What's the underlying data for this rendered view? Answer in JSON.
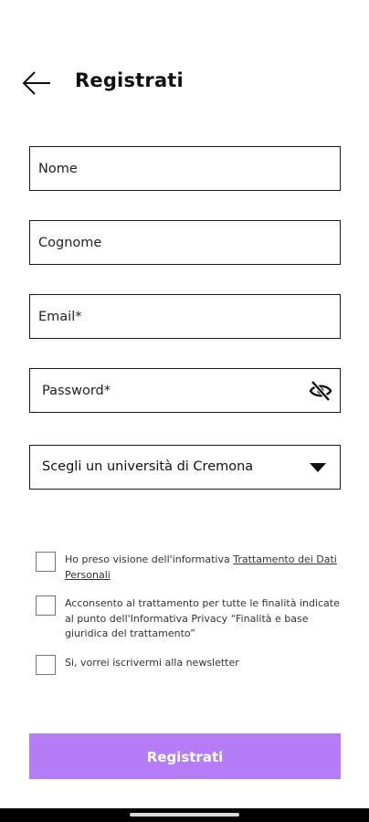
{
  "header": {
    "title": "Registrati",
    "back_icon": "arrow-left-icon"
  },
  "form": {
    "nome_placeholder": "Nome",
    "cognome_placeholder": "Cognome",
    "email_placeholder": "Email*",
    "password_placeholder": "Password*",
    "password_toggle_icon": "eye-off-icon",
    "university_select": {
      "value": "Scegli un università di Cremona",
      "icon": "caret-down-icon"
    }
  },
  "consents": [
    {
      "text": "Ho preso visione dell'informativa ",
      "link": "Trattamento dei Dati Personali",
      "checked": false
    },
    {
      "text": "Acconsento al trattamento per tutte le finalità indicate al punto dell'Informativa Privacy “Finalità e base giuridica del trattamento”",
      "checked": false
    },
    {
      "text": "Si, vorrei iscrivermi alla newsletter",
      "checked": false
    }
  ],
  "submit_label": "Registrati",
  "colors": {
    "accent": "#b47cf7",
    "border": "#1a1a1a",
    "text": "#111111"
  }
}
